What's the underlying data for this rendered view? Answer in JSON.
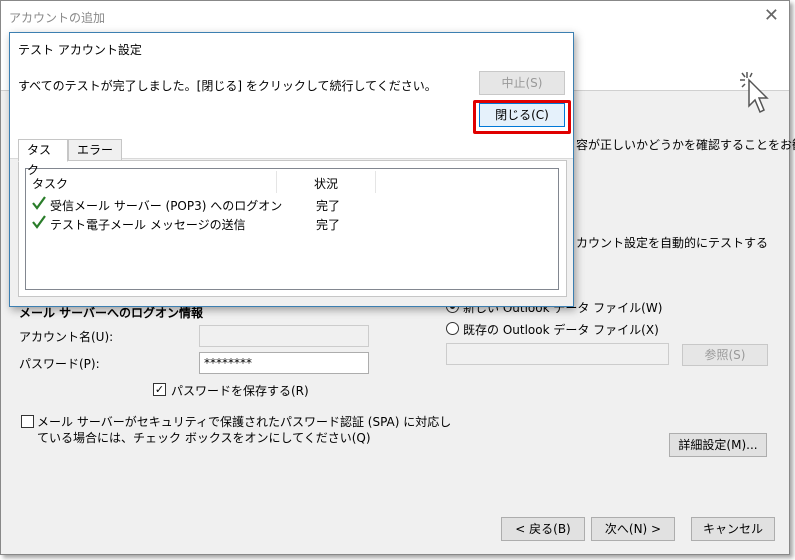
{
  "main_window": {
    "title": "アカウントの追加",
    "partial_text_1": "容が正しいかどうかを確認することをお勧め",
    "partial_text_2": "カウント設定を自動的にテストする",
    "login_section": {
      "heading": "メール サーバーへのログオン情報",
      "account_label": "アカウント名(U):",
      "account_value": "",
      "password_label": "パスワード(P):",
      "password_value": "********",
      "save_password_label": "パスワードを保存する(R)",
      "save_password_checked": true,
      "spa_label_line1": "メール サーバーがセキュリティで保護されたパスワード認証 (SPA) に対応し",
      "spa_label_line2": "ている場合には、チェック ボックスをオンにしてください(Q)",
      "spa_checked": false
    },
    "delivery": {
      "new_file_label": "新しい Outlook データ ファイル(W)",
      "existing_file_label": "既存の Outlook データ ファイル(X)",
      "path_value": "",
      "browse_label": "参照(S)"
    },
    "more_settings_label": "詳細設定(M)...",
    "buttons": {
      "back": "< 戻る(B)",
      "next": "次へ(N) >",
      "cancel": "キャンセル"
    }
  },
  "dialog": {
    "title": "テスト アカウント設定",
    "message": "すべてのテストが完了しました。[閉じる] をクリックして続行してください。",
    "stop_label": "中止(S)",
    "close_label": "閉じる(C)",
    "tabs": [
      "タスク",
      "エラー"
    ],
    "columns": [
      "タスク",
      "状況"
    ],
    "rows": [
      {
        "task": "受信メール サーバー (POP3) へのログオン",
        "status": "完了",
        "icon": "check-icon"
      },
      {
        "task": "テスト電子メール メッセージの送信",
        "status": "完了",
        "icon": "check-icon"
      }
    ]
  },
  "colors": {
    "highlight": "#e00000",
    "check": "#2a7d2a"
  }
}
